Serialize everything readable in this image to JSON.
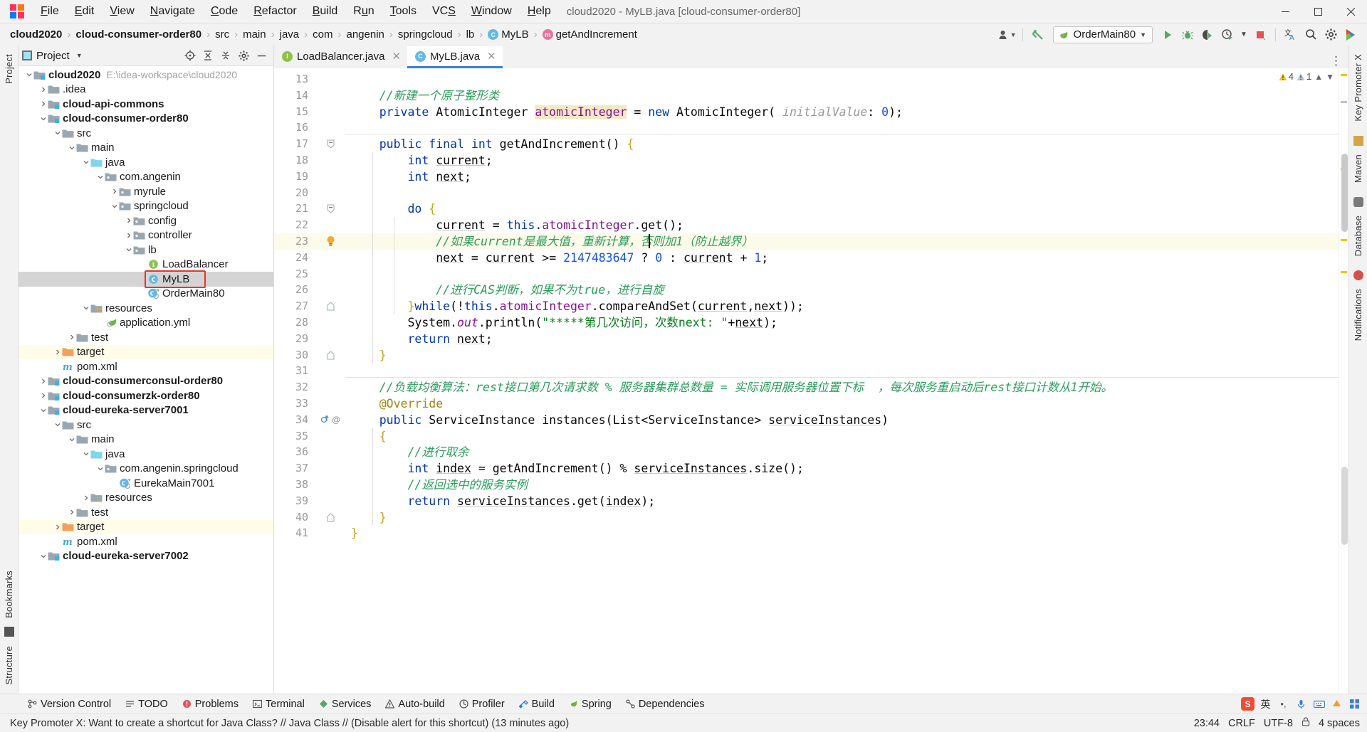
{
  "window": {
    "title": "cloud2020 - MyLB.java [cloud-consumer-order80]",
    "minimize": "–",
    "maximize": "❐",
    "close": "✕"
  },
  "menubar": {
    "items": [
      {
        "label": "File"
      },
      {
        "label": "Edit"
      },
      {
        "label": "View"
      },
      {
        "label": "Navigate"
      },
      {
        "label": "Code"
      },
      {
        "label": "Refactor"
      },
      {
        "label": "Build"
      },
      {
        "label": "Run"
      },
      {
        "label": "Tools"
      },
      {
        "label": "VCS"
      },
      {
        "label": "Window"
      },
      {
        "label": "Help"
      }
    ]
  },
  "breadcrumb": {
    "items": [
      {
        "label": "cloud2020",
        "bold": true,
        "icon": ""
      },
      {
        "label": "cloud-consumer-order80",
        "bold": true,
        "icon": ""
      },
      {
        "label": "src",
        "bold": false,
        "icon": ""
      },
      {
        "label": "main",
        "bold": false,
        "icon": ""
      },
      {
        "label": "java",
        "bold": false,
        "icon": ""
      },
      {
        "label": "com",
        "bold": false,
        "icon": ""
      },
      {
        "label": "angenin",
        "bold": false,
        "icon": ""
      },
      {
        "label": "springcloud",
        "bold": false,
        "icon": ""
      },
      {
        "label": "lb",
        "bold": false,
        "icon": ""
      },
      {
        "label": "MyLB",
        "bold": false,
        "icon": "class-icon"
      },
      {
        "label": "getAndIncrement",
        "bold": false,
        "icon": "method-icon"
      }
    ],
    "separator": "›"
  },
  "toolbar": {
    "run_config": "OrderMain80",
    "run_config_chevron": "▾",
    "user_chevron": "▾",
    "icons": [
      "user-icon",
      "update-project-icon",
      "run-icon",
      "debug-icon",
      "run-with-coverage-icon",
      "profiler-icon",
      "stop-icon",
      "translate-icon",
      "search-everywhere-icon",
      "settings-icon",
      "ide-help-icon"
    ]
  },
  "left_rail": {
    "top": "Project",
    "bottom": [
      "Bookmarks",
      "Structure"
    ]
  },
  "right_rail": {
    "items": [
      "Key Promoter X",
      "Maven",
      "Database",
      "Notifications"
    ]
  },
  "project_panel": {
    "title": "Project",
    "chevron": "▾",
    "header_icons": [
      "locate-icon",
      "expand-all-icon",
      "collapse-all-icon",
      "settings-icon",
      "hide-icon"
    ],
    "tree": [
      {
        "depth": 0,
        "twist": "v",
        "icon": "module-root",
        "label": "cloud2020",
        "bold": true,
        "path": "E:\\idea-workspace\\cloud2020"
      },
      {
        "depth": 1,
        "twist": ">",
        "icon": "folder",
        "label": ".idea",
        "bold": false
      },
      {
        "depth": 1,
        "twist": ">",
        "icon": "module-root",
        "label": "cloud-api-commons",
        "bold": true
      },
      {
        "depth": 1,
        "twist": "v",
        "icon": "module-root",
        "label": "cloud-consumer-order80",
        "bold": true
      },
      {
        "depth": 2,
        "twist": "v",
        "icon": "folder",
        "label": "src",
        "bold": false
      },
      {
        "depth": 3,
        "twist": "v",
        "icon": "folder",
        "label": "main",
        "bold": false
      },
      {
        "depth": 4,
        "twist": "v",
        "icon": "source-folder",
        "label": "java",
        "bold": false
      },
      {
        "depth": 5,
        "twist": "v",
        "icon": "package",
        "label": "com.angenin",
        "bold": false
      },
      {
        "depth": 6,
        "twist": ">",
        "icon": "package",
        "label": "myrule",
        "bold": false
      },
      {
        "depth": 6,
        "twist": "v",
        "icon": "package",
        "label": "springcloud",
        "bold": false
      },
      {
        "depth": 7,
        "twist": ">",
        "icon": "package",
        "label": "config",
        "bold": false
      },
      {
        "depth": 7,
        "twist": ">",
        "icon": "package",
        "label": "controller",
        "bold": false
      },
      {
        "depth": 7,
        "twist": "v",
        "icon": "package",
        "label": "lb",
        "bold": false
      },
      {
        "depth": 8,
        "twist": "",
        "icon": "interface",
        "label": "LoadBalancer",
        "bold": false
      },
      {
        "depth": 8,
        "twist": "",
        "icon": "class",
        "label": "MyLB",
        "bold": false,
        "selected": true,
        "highlight_box": true
      },
      {
        "depth": 8,
        "twist": "",
        "icon": "spring-class",
        "label": "OrderMain80",
        "bold": false
      },
      {
        "depth": 4,
        "twist": "v",
        "icon": "resource-folder",
        "label": "resources",
        "bold": false
      },
      {
        "depth": 5,
        "twist": "",
        "icon": "spring-yml",
        "label": "application.yml",
        "bold": false
      },
      {
        "depth": 3,
        "twist": ">",
        "icon": "folder",
        "label": "test",
        "bold": false
      },
      {
        "depth": 2,
        "twist": ">",
        "icon": "target-folder",
        "label": "target",
        "bold": false,
        "yellow": true
      },
      {
        "depth": 2,
        "twist": "",
        "icon": "maven",
        "label": "pom.xml",
        "bold": false
      },
      {
        "depth": 1,
        "twist": ">",
        "icon": "module-root",
        "label": "cloud-consumerconsul-order80",
        "bold": true
      },
      {
        "depth": 1,
        "twist": ">",
        "icon": "module-root",
        "label": "cloud-consumerzk-order80",
        "bold": true
      },
      {
        "depth": 1,
        "twist": "v",
        "icon": "module-root",
        "label": "cloud-eureka-server7001",
        "bold": true
      },
      {
        "depth": 2,
        "twist": "v",
        "icon": "folder",
        "label": "src",
        "bold": false
      },
      {
        "depth": 3,
        "twist": "v",
        "icon": "folder",
        "label": "main",
        "bold": false
      },
      {
        "depth": 4,
        "twist": "v",
        "icon": "source-folder",
        "label": "java",
        "bold": false
      },
      {
        "depth": 5,
        "twist": "v",
        "icon": "package",
        "label": "com.angenin.springcloud",
        "bold": false
      },
      {
        "depth": 6,
        "twist": "",
        "icon": "spring-class",
        "label": "EurekaMain7001",
        "bold": false
      },
      {
        "depth": 4,
        "twist": ">",
        "icon": "resource-folder",
        "label": "resources",
        "bold": false
      },
      {
        "depth": 3,
        "twist": ">",
        "icon": "folder",
        "label": "test",
        "bold": false
      },
      {
        "depth": 2,
        "twist": ">",
        "icon": "target-folder",
        "label": "target",
        "bold": false,
        "yellow": true
      },
      {
        "depth": 2,
        "twist": "",
        "icon": "maven",
        "label": "pom.xml",
        "bold": false
      },
      {
        "depth": 1,
        "twist": "v",
        "icon": "module-root",
        "label": "cloud-eureka-server7002",
        "bold": true
      }
    ]
  },
  "editor": {
    "tabs": [
      {
        "label": "LoadBalancer.java",
        "icon": "interface-icon",
        "active": false,
        "close": "✕"
      },
      {
        "label": "MyLB.java",
        "icon": "class-icon",
        "active": true,
        "close": "✕"
      }
    ],
    "inspection": {
      "warnings": "4",
      "weak_warnings": "1",
      "warn_icon": "warning-triangle",
      "weak_icon": "weak-warning-triangle",
      "chevron_up": "∧",
      "chevron_down": "∨"
    },
    "first_line_number": 13,
    "caret_line": 23,
    "lines": [
      {
        "n": 13,
        "text": ""
      },
      {
        "n": 14,
        "text": "    //新建一个原子整形类"
      },
      {
        "n": 15,
        "text": "    private AtomicInteger atomicInteger = new AtomicInteger( initialValue: 0);"
      },
      {
        "n": 16,
        "text": ""
      },
      {
        "n": 17,
        "text": "    public final int getAndIncrement() {"
      },
      {
        "n": 18,
        "text": "        int current;"
      },
      {
        "n": 19,
        "text": "        int next;"
      },
      {
        "n": 20,
        "text": ""
      },
      {
        "n": 21,
        "text": "        do {"
      },
      {
        "n": 22,
        "text": "            current = this.atomicInteger.get();"
      },
      {
        "n": 23,
        "text": "            //如果current是最大值，重新计算，否则加1（防止越界）"
      },
      {
        "n": 24,
        "text": "            next = current >= 2147483647 ? 0 : current + 1;"
      },
      {
        "n": 25,
        "text": ""
      },
      {
        "n": 26,
        "text": "            //进行CAS判断，如果不为true，进行自旋"
      },
      {
        "n": 27,
        "text": "        }while(!this.atomicInteger.compareAndSet(current,next));"
      },
      {
        "n": 28,
        "text": "        System.out.println(\"*****第几次访问，次数next: \"+next);"
      },
      {
        "n": 29,
        "text": "        return next;"
      },
      {
        "n": 30,
        "text": "    }"
      },
      {
        "n": 31,
        "text": ""
      },
      {
        "n": 32,
        "text": "    //负载均衡算法：rest接口第几次请求数 % 服务器集群总数量 = 实际调用服务器位置下标  ，每次服务重启动后rest接口计数从1开始。"
      },
      {
        "n": 33,
        "text": "    @Override"
      },
      {
        "n": 34,
        "text": "    public ServiceInstance instances(List<ServiceInstance> serviceInstances)"
      },
      {
        "n": 35,
        "text": "    {"
      },
      {
        "n": 36,
        "text": "        //进行取余"
      },
      {
        "n": 37,
        "text": "        int index = getAndIncrement() % serviceInstances.size();"
      },
      {
        "n": 38,
        "text": "        //返回选中的服务实例"
      },
      {
        "n": 39,
        "text": "        return serviceInstances.get(index);"
      },
      {
        "n": 40,
        "text": "    }"
      },
      {
        "n": 41,
        "text": "}"
      }
    ]
  },
  "bottom_toolbar": {
    "items": [
      {
        "label": "Version Control",
        "icon": "branch-icon"
      },
      {
        "label": "TODO",
        "icon": "todo-icon"
      },
      {
        "label": "Problems",
        "icon": "problems-icon"
      },
      {
        "label": "Terminal",
        "icon": "terminal-icon"
      },
      {
        "label": "Services",
        "icon": "services-icon"
      },
      {
        "label": "Auto-build",
        "icon": "autobuild-icon"
      },
      {
        "label": "Profiler",
        "icon": "profiler-icon"
      },
      {
        "label": "Build",
        "icon": "build-icon"
      },
      {
        "label": "Spring",
        "icon": "spring-icon"
      },
      {
        "label": "Dependencies",
        "icon": "dependencies-icon"
      }
    ]
  },
  "statusbar": {
    "message": "Key Promoter X: Want to create a shortcut for Java Class? // Java Class // (Disable alert for this shortcut) (13 minutes ago)",
    "time": "23:44",
    "line_separator": "CRLF",
    "encoding": "UTF-8",
    "indent": "4 spaces",
    "lock_icon": "lock-icon",
    "tray": [
      "sogou-icon",
      "lang-cn",
      "toolbar-more",
      "mic-icon",
      "keyboard-icon",
      "emoji-icon",
      "grid-icon"
    ],
    "lang": "英"
  }
}
